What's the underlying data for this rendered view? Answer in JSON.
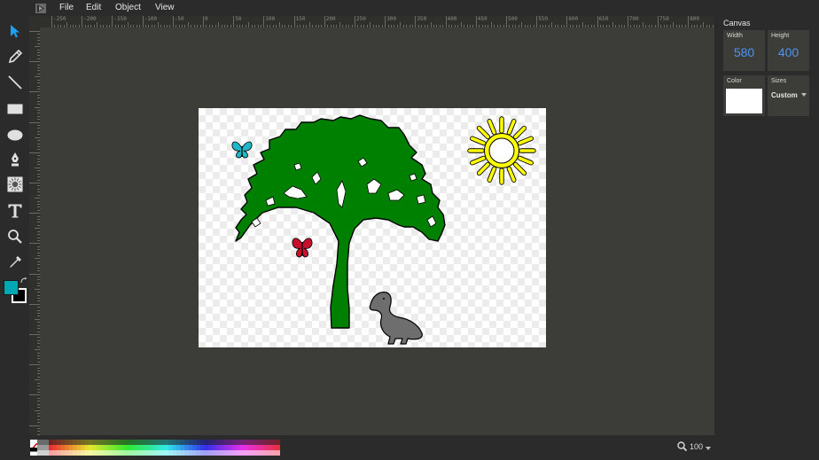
{
  "menu": {
    "items": [
      "File",
      "Edit",
      "Object",
      "View"
    ]
  },
  "ruler": {
    "top_labels": [
      "-250",
      "-200",
      "-150",
      "-100",
      "-50",
      "0",
      "50",
      "100",
      "150",
      "200",
      "250",
      "300",
      "350",
      "400",
      "450",
      "500",
      "550",
      "600",
      "650",
      "700",
      "750",
      "800"
    ]
  },
  "toolbar": {
    "tools": [
      "select-tool",
      "pencil-tool",
      "line-tool",
      "rectangle-tool",
      "ellipse-tool",
      "pen-tool",
      "shape-library-tool",
      "text-tool",
      "zoom-tool",
      "eyedropper-tool"
    ],
    "fill_color": "#00a8b4",
    "stroke_color": "#000000"
  },
  "panel": {
    "title": "Canvas",
    "width_label": "Width",
    "width_value": "580",
    "height_label": "Height",
    "height_value": "400",
    "color_label": "Color",
    "canvas_color": "#ffffff",
    "sizes_label": "Sizes",
    "sizes_value": "Custom"
  },
  "drawing": {
    "objects": [
      "tree",
      "sun",
      "butterfly-cyan",
      "butterfly-red",
      "duck"
    ],
    "colors": {
      "tree": "#008000",
      "sun": "#ffff00",
      "butterfly_cyan": "#20b8c8",
      "butterfly_red": "#c8102e",
      "duck": "#6e6e6e"
    }
  },
  "bottom": {
    "zoom_value": "100"
  },
  "colors": {
    "accent": "#4d95f0",
    "chrome": "#2b2b2b",
    "workspace": "#3c3c38"
  }
}
